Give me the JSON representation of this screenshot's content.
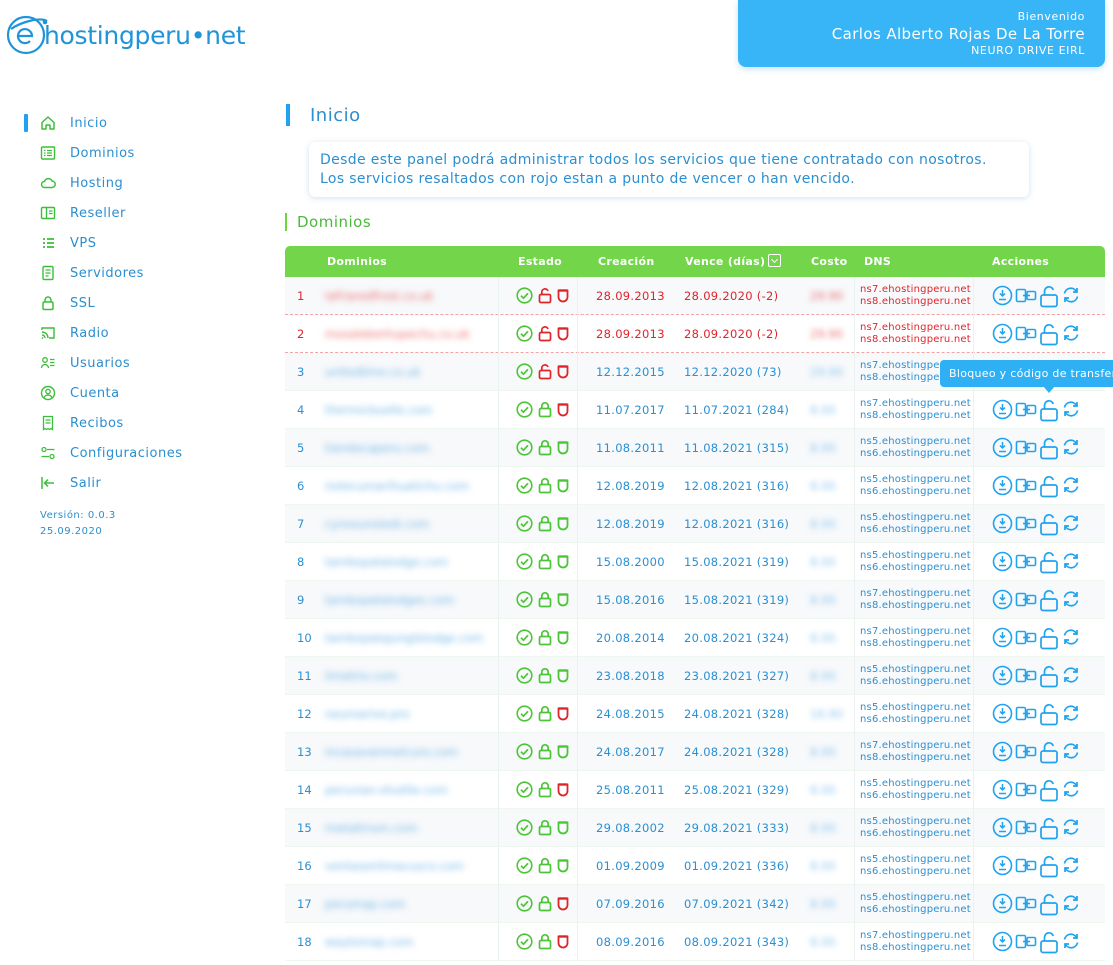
{
  "brand": {
    "name": "hostingperu",
    "dot": "•",
    "tld": "net"
  },
  "user": {
    "welcome": "Bienvenido",
    "name": "Carlos Alberto Rojas De La Torre",
    "company": "NEURO DRIVE EIRL"
  },
  "colors": {
    "accent": "#1fa2ef",
    "green": "#72d54a",
    "danger": "#e0242c",
    "text": "#2b8fd0"
  },
  "sidebar": {
    "items": [
      {
        "label": "Inicio",
        "icon": "home-icon",
        "active": true
      },
      {
        "label": "Dominios",
        "icon": "list-icon"
      },
      {
        "label": "Hosting",
        "icon": "cloud-icon"
      },
      {
        "label": "Reseller",
        "icon": "book-icon"
      },
      {
        "label": "VPS",
        "icon": "server-list-icon"
      },
      {
        "label": "Servidores",
        "icon": "document-icon"
      },
      {
        "label": "SSL",
        "icon": "lock-icon"
      },
      {
        "label": "Radio",
        "icon": "cast-icon"
      },
      {
        "label": "Usuarios",
        "icon": "users-icon"
      },
      {
        "label": "Cuenta",
        "icon": "account-icon"
      },
      {
        "label": "Recibos",
        "icon": "receipt-icon"
      },
      {
        "label": "Configuraciones",
        "icon": "settings-icon"
      },
      {
        "label": "Salir",
        "icon": "logout-icon"
      }
    ],
    "version": "Versión: 0.0.3",
    "version_date": "25.09.2020"
  },
  "main": {
    "title": "Inicio",
    "info_line1": "Desde este panel podrá administrar todos los servicios que tiene contratado con nosotros.",
    "info_line2": "Los servicios resaltados con rojo estan a punto de vencer o han vencido.",
    "section_title": "Dominios"
  },
  "table": {
    "headers": {
      "dominios": "Dominios",
      "estado": "Estado",
      "creacion": "Creación",
      "vence": "Vence (días)",
      "costo": "Costo",
      "dns": "DNS",
      "acciones": "Acciones"
    },
    "rows": [
      {
        "n": "1",
        "domain": "lafriaredfrost.co.uk",
        "creacion": "28.09.2013",
        "vence": "28.09.2020 (-2)",
        "costo": "29.90",
        "dns1": "ns7.ehostingperu.net",
        "dns2": "ns8.ehostingperu.net",
        "expiring": true,
        "locked": false,
        "shield": "red"
      },
      {
        "n": "2",
        "domain": "mosaleberhupechu.co.uk",
        "creacion": "28.09.2013",
        "vence": "28.09.2020 (-2)",
        "costo": "29.90",
        "dns1": "ns7.ehostingperu.net",
        "dns2": "ns8.ehostingperu.net",
        "expiring": true,
        "locked": false,
        "shield": "red"
      },
      {
        "n": "3",
        "domain": "unitedlimo.co.uk",
        "creacion": "12.12.2015",
        "vence": "12.12.2020 (73)",
        "costo": "29.90",
        "dns1": "ns7.ehostingperu.net",
        "dns2": "ns8.ehostingperu.net",
        "expiring": false,
        "locked": false,
        "shield": "red"
      },
      {
        "n": "4",
        "domain": "thermicbuelle.com",
        "creacion": "11.07.2017",
        "vence": "11.07.2021 (284)",
        "costo": "8.00",
        "dns1": "ns7.ehostingperu.net",
        "dns2": "ns8.ehostingperu.net",
        "expiring": false,
        "locked": true,
        "shield": "red"
      },
      {
        "n": "5",
        "domain": "tiendocaperu.com",
        "creacion": "11.08.2011",
        "vence": "11.08.2021 (315)",
        "costo": "8.00",
        "dns1": "ns5.ehostingperu.net",
        "dns2": "ns6.ehostingperu.net",
        "expiring": false,
        "locked": true,
        "shield": "green"
      },
      {
        "n": "6",
        "domain": "notecumarihuatichu.com",
        "creacion": "12.08.2019",
        "vence": "12.08.2021 (316)",
        "costo": "8.00",
        "dns1": "ns5.ehostingperu.net",
        "dns2": "ns6.ehostingperu.net",
        "expiring": false,
        "locked": true,
        "shield": "green"
      },
      {
        "n": "7",
        "domain": "cynosunstedi.com",
        "creacion": "12.08.2019",
        "vence": "12.08.2021 (316)",
        "costo": "8.00",
        "dns1": "ns5.ehostingperu.net",
        "dns2": "ns6.ehostingperu.net",
        "expiring": false,
        "locked": true,
        "shield": "green"
      },
      {
        "n": "8",
        "domain": "tambopatalodge.com",
        "creacion": "15.08.2000",
        "vence": "15.08.2021 (319)",
        "costo": "8.00",
        "dns1": "ns5.ehostingperu.net",
        "dns2": "ns6.ehostingperu.net",
        "expiring": false,
        "locked": true,
        "shield": "green"
      },
      {
        "n": "9",
        "domain": "tambopatalodges.com",
        "creacion": "15.08.2016",
        "vence": "15.08.2021 (319)",
        "costo": "8.00",
        "dns1": "ns7.ehostingperu.net",
        "dns2": "ns8.ehostingperu.net",
        "expiring": false,
        "locked": true,
        "shield": "green"
      },
      {
        "n": "10",
        "domain": "tambopatajunglelodge.com",
        "creacion": "20.08.2014",
        "vence": "20.08.2021 (324)",
        "costo": "8.00",
        "dns1": "ns7.ehostingperu.net",
        "dns2": "ns8.ehostingperu.net",
        "expiring": false,
        "locked": true,
        "shield": "green"
      },
      {
        "n": "11",
        "domain": "limetrio.com",
        "creacion": "23.08.2018",
        "vence": "23.08.2021 (327)",
        "costo": "8.00",
        "dns1": "ns5.ehostingperu.net",
        "dns2": "ns6.ehostingperu.net",
        "expiring": false,
        "locked": true,
        "shield": "green"
      },
      {
        "n": "12",
        "domain": "neuroarive.pro",
        "creacion": "24.08.2015",
        "vence": "24.08.2021 (328)",
        "costo": "16.90",
        "dns1": "ns5.ehostingperu.net",
        "dns2": "ns6.ehostingperu.net",
        "expiring": false,
        "locked": true,
        "shield": "red"
      },
      {
        "n": "13",
        "domain": "incasavanmelcuro.com",
        "creacion": "24.08.2017",
        "vence": "24.08.2021 (328)",
        "costo": "8.00",
        "dns1": "ns7.ehostingperu.net",
        "dns2": "ns8.ehostingperu.net",
        "expiring": false,
        "locked": true,
        "shield": "green"
      },
      {
        "n": "14",
        "domain": "peruvian-shuttle.com",
        "creacion": "25.08.2011",
        "vence": "25.08.2021 (329)",
        "costo": "8.00",
        "dns1": "ns5.ehostingperu.net",
        "dns2": "ns6.ehostingperu.net",
        "expiring": false,
        "locked": true,
        "shield": "red"
      },
      {
        "n": "15",
        "domain": "metaltrium.com",
        "creacion": "29.08.2002",
        "vence": "29.08.2021 (333)",
        "costo": "8.00",
        "dns1": "ns5.ehostingperu.net",
        "dns2": "ns6.ehostingperu.net",
        "expiring": false,
        "locked": true,
        "shield": "green"
      },
      {
        "n": "16",
        "domain": "ventasenlimacusco.com",
        "creacion": "01.09.2009",
        "vence": "01.09.2021 (336)",
        "costo": "8.00",
        "dns1": "ns5.ehostingperu.net",
        "dns2": "ns6.ehostingperu.net",
        "expiring": false,
        "locked": true,
        "shield": "green"
      },
      {
        "n": "17",
        "domain": "perumap.com",
        "creacion": "07.09.2016",
        "vence": "07.09.2021 (342)",
        "costo": "8.00",
        "dns1": "ns5.ehostingperu.net",
        "dns2": "ns6.ehostingperu.net",
        "expiring": false,
        "locked": true,
        "shield": "red"
      },
      {
        "n": "18",
        "domain": "waytomap.com",
        "creacion": "08.09.2016",
        "vence": "08.09.2021 (343)",
        "costo": "8.00",
        "dns1": "ns7.ehostingperu.net",
        "dns2": "ns8.ehostingperu.net",
        "expiring": false,
        "locked": true,
        "shield": "red"
      }
    ]
  },
  "tooltip": {
    "text": "Bloqueo y código de transferencia"
  }
}
